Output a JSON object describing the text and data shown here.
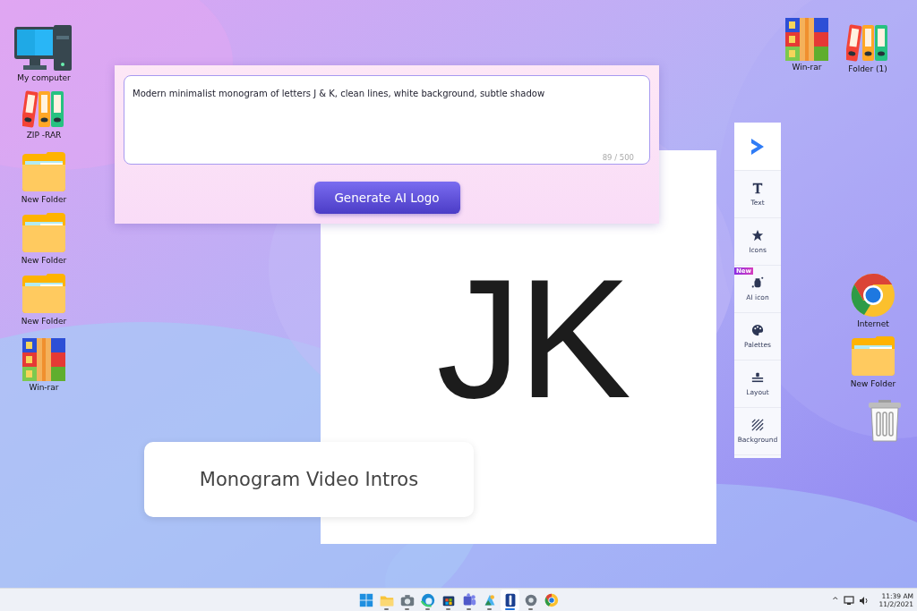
{
  "desktop_icons": [
    {
      "kind": "computer",
      "label": "My computer"
    },
    {
      "kind": "binders",
      "label": "ZIP -RAR"
    },
    {
      "kind": "folder",
      "label": "New Folder"
    },
    {
      "kind": "folder",
      "label": "New Folder"
    },
    {
      "kind": "folder",
      "label": "New Folder"
    },
    {
      "kind": "winrar",
      "label": "Win-rar"
    },
    {
      "kind": "winrar",
      "label": "Win-rar"
    },
    {
      "kind": "binders",
      "label": "Folder (1)"
    },
    {
      "kind": "chrome",
      "label": "Internet"
    },
    {
      "kind": "folder",
      "label": "New Folder"
    },
    {
      "kind": "trash"
    }
  ],
  "prompt_panel": {
    "prompt": {
      "value": "Modern minimalist monogram of letters J & K, clean lines, white background, subtle shadow",
      "counter": "89 / 500"
    },
    "button": "Generate AI Logo"
  },
  "canvas": {
    "logo_text": "JK"
  },
  "caption": "Monogram Video Intros",
  "toolbar": {
    "items": [
      {
        "kind": "text",
        "label": "Text"
      },
      {
        "kind": "star",
        "label": "Icons"
      },
      {
        "kind": "ai",
        "label": "AI icon",
        "badge": "New"
      },
      {
        "kind": "palette",
        "label": "Palettes"
      },
      {
        "kind": "layout",
        "label": "Layout"
      },
      {
        "kind": "background",
        "label": "Background"
      }
    ]
  },
  "taskbar": {
    "apps": [
      {
        "kind": "start",
        "running": false,
        "selected": false
      },
      {
        "kind": "files",
        "running": true,
        "selected": false
      },
      {
        "kind": "camera",
        "running": true,
        "selected": false
      },
      {
        "kind": "edge",
        "running": true,
        "selected": false
      },
      {
        "kind": "store",
        "running": true,
        "selected": false
      },
      {
        "kind": "teams",
        "running": true,
        "selected": false
      },
      {
        "kind": "photos",
        "running": true,
        "selected": false
      },
      {
        "kind": "app",
        "running": true,
        "selected": true
      },
      {
        "kind": "settings",
        "running": true,
        "selected": false
      },
      {
        "kind": "chrome",
        "running": false,
        "selected": false
      }
    ],
    "tray": {
      "chevron": "^",
      "time": "11:39 AM",
      "date": "11/2/2021"
    }
  }
}
